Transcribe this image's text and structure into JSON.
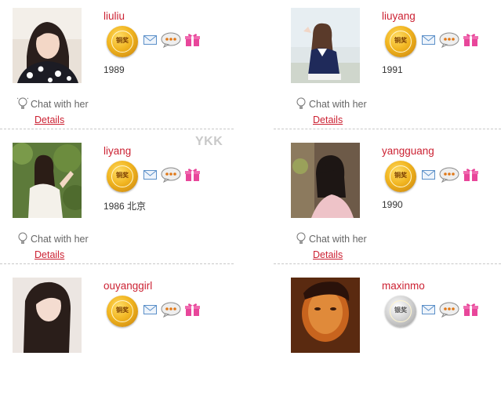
{
  "profiles": [
    {
      "name": "liuliu",
      "info": "1989",
      "medal": "铜奖",
      "medal_color": "gold",
      "chat": "Chat with her",
      "details": "Details"
    },
    {
      "name": "liuyang",
      "info": "1991",
      "medal": "铜奖",
      "medal_color": "gold",
      "chat": "Chat with her",
      "details": "Details"
    },
    {
      "name": "liyang",
      "info": "1986 北京",
      "medal": "铜奖",
      "medal_color": "gold",
      "chat": "Chat with her",
      "details": "Details"
    },
    {
      "name": "yangguang",
      "info": "1990",
      "medal": "铜奖",
      "medal_color": "gold",
      "chat": "Chat with her",
      "details": "Details"
    },
    {
      "name": "ouyanggirl",
      "info": "",
      "medal": "铜奖",
      "medal_color": "gold",
      "chat": "",
      "details": ""
    },
    {
      "name": "maxinmo",
      "info": "",
      "medal": "银奖",
      "medal_color": "silver",
      "chat": "",
      "details": ""
    }
  ],
  "watermark": "YKK",
  "colors": {
    "name": "#cc2233",
    "link": "#cc2233",
    "chat": "#666666",
    "gift": "#e8469a",
    "mail": "#5a8fc8"
  },
  "icons": [
    "medal-icon",
    "mail-icon",
    "chat-bubble-icon",
    "gift-icon",
    "lightbulb-icon"
  ]
}
